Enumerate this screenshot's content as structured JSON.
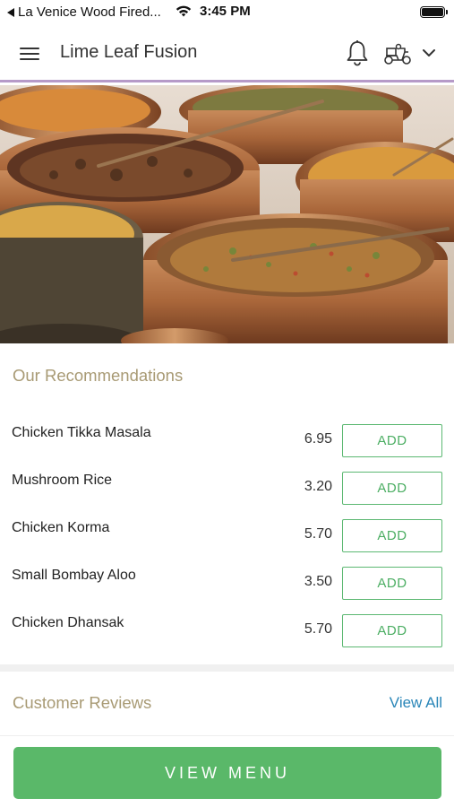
{
  "status_bar": {
    "back_label": "La Venice Wood Fired...",
    "time": "3:45 PM"
  },
  "header": {
    "title": "Lime Leaf Fusion",
    "icons": [
      "menu-icon",
      "bell-icon",
      "delivery-scooter-icon",
      "chevron-down-icon"
    ]
  },
  "recommendations": {
    "title": "Our Recommendations",
    "add_label": "ADD",
    "items": [
      {
        "name": "Chicken Tikka Masala",
        "price": "6.95"
      },
      {
        "name": "Mushroom Rice",
        "price": "3.20"
      },
      {
        "name": "Chicken Korma",
        "price": "5.70"
      },
      {
        "name": "Small Bombay Aloo",
        "price": "3.50"
      },
      {
        "name": "Chicken Dhansak",
        "price": "5.70"
      }
    ]
  },
  "reviews": {
    "title": "Customer Reviews",
    "view_all": "View All"
  },
  "bottom": {
    "view_menu": "VIEW MENU"
  },
  "colors": {
    "accent_green": "#5ab869",
    "section_title": "#a89a74",
    "link_blue": "#2a86b8",
    "header_border": "#b69ac8"
  }
}
